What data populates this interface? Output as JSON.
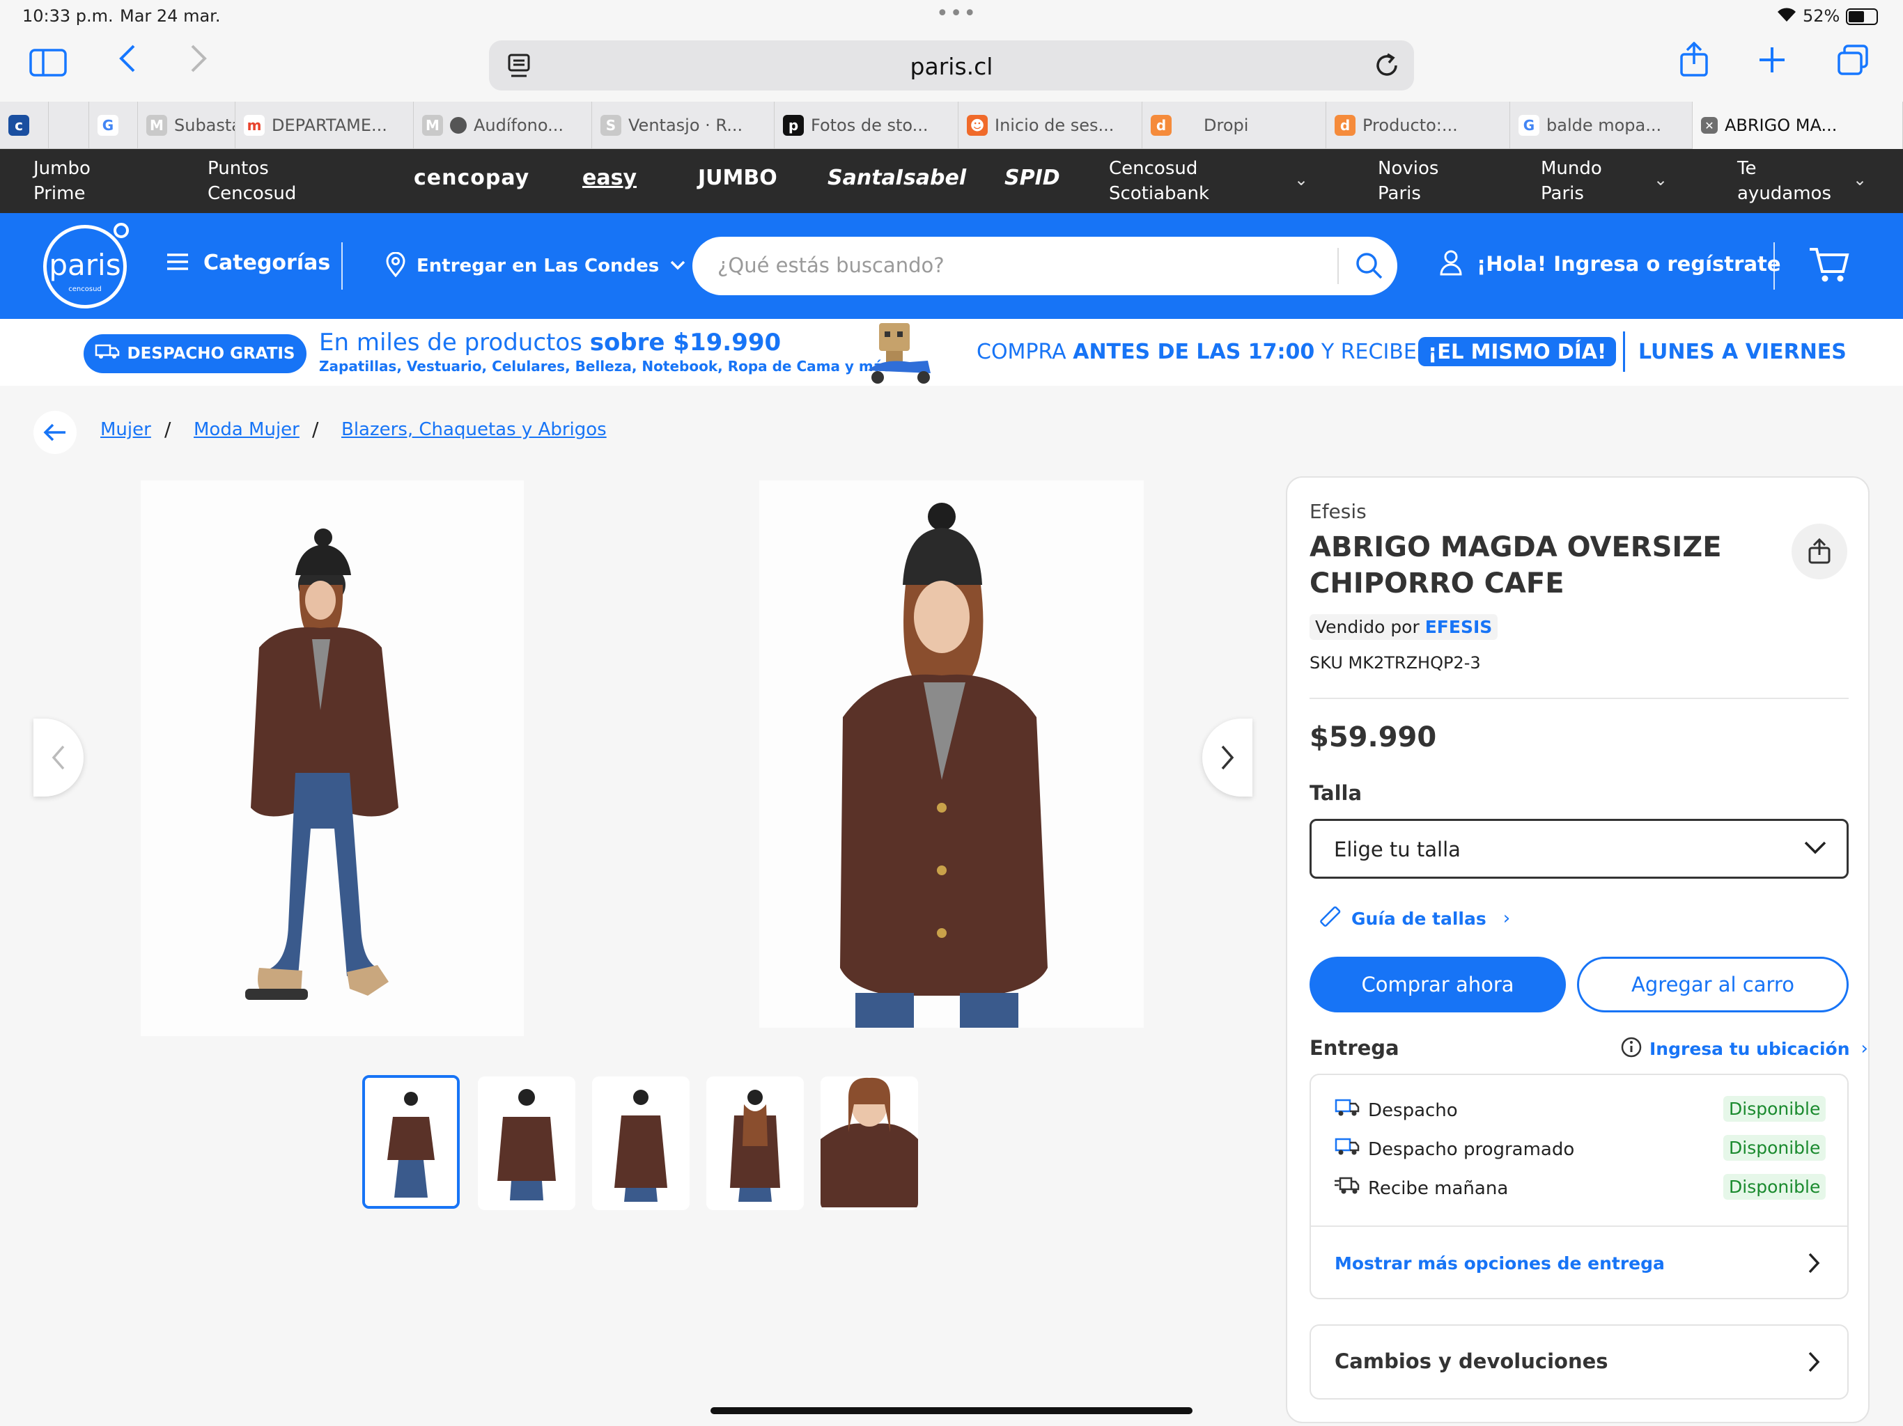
{
  "status": {
    "time": "10:33 p.m.",
    "date": "Mar 24 mar.",
    "battery": "52%"
  },
  "browser": {
    "url": "paris.cl",
    "tabs": [
      {
        "label": "",
        "icon": "cencosud-icon"
      },
      {
        "label": "",
        "icon": "blank"
      },
      {
        "label": "",
        "icon": "google-icon"
      },
      {
        "label": "Subasta",
        "icon": "gmail-icon"
      },
      {
        "label": "DEPARTAME...",
        "icon": "mercadolibre-icon"
      },
      {
        "label": "Audífono...",
        "icon": "gmail-icon"
      },
      {
        "label": "Ventasjo · R...",
        "icon": "s-icon"
      },
      {
        "label": "Fotos de sto...",
        "icon": "photo-icon"
      },
      {
        "label": "Inicio de ses...",
        "icon": "bot-icon"
      },
      {
        "label": "Dropi",
        "icon": "dropi-icon"
      },
      {
        "label": "Producto:...",
        "icon": "dropi-icon"
      },
      {
        "label": "balde mopa...",
        "icon": "google-icon"
      },
      {
        "label": "ABRIGO MA...",
        "icon": "close-icon"
      }
    ]
  },
  "sitesbar": {
    "jumbo_prime": [
      "Jumbo",
      "Prime"
    ],
    "puntos": [
      "Puntos",
      "Cencosud"
    ],
    "brands": [
      "cencopay",
      "easy",
      "JUMBO",
      "SantaIsabel",
      "SPID"
    ],
    "scotiabank": [
      "Cencosud",
      "Scotiabank"
    ],
    "novios": [
      "Novios",
      "Paris"
    ],
    "mundo": [
      "Mundo",
      "Paris"
    ],
    "ayuda": [
      "Te",
      "ayudamos"
    ]
  },
  "header": {
    "logo_text": "paris",
    "logo_sub": "cencosud",
    "categories": "Categorías",
    "delivery": "Entregar en Las Condes",
    "search_placeholder": "¿Qué estás buscando?",
    "login": "¡Hola! Ingresa o regístrate"
  },
  "promo": {
    "pill": "DESPACHO GRATIS",
    "line1_a": "En miles de productos ",
    "line1_b": "sobre $19.990",
    "line2": "Zapatillas, Vestuario, Celulares, Belleza, Notebook, Ropa de Cama y más!",
    "compra_a": "COMPRA ",
    "compra_b": "ANTES DE LAS 17:00",
    "compra_c": " Y RECIBE",
    "mismo_dia": "¡EL MISMO DÍA!",
    "lunes": "LUNES A VIERNES"
  },
  "breadcrumb": [
    "Mujer",
    "Moda Mujer",
    "Blazers, Chaquetas y Abrigos"
  ],
  "product": {
    "brand": "Efesis",
    "title_line1": "ABRIGO MAGDA OVERSIZE",
    "title_line2": "CHIPORRO CAFE",
    "sold_by_label": "Vendido por",
    "seller": "EFESIS",
    "sku": "SKU MK2TRZHQP2-3",
    "price": "$59.990",
    "size_label": "Talla",
    "size_placeholder": "Elige tu talla",
    "size_guide": "Guía de tallas",
    "buy_now": "Comprar ahora",
    "add_to_cart": "Agregar al carro",
    "delivery_label": "Entrega",
    "location_link": "Ingresa tu ubicación",
    "delivery_options": [
      {
        "name": "Despacho",
        "status": "Disponible"
      },
      {
        "name": "Despacho programado",
        "status": "Disponible"
      },
      {
        "name": "Recibe mañana",
        "status": "Disponible"
      }
    ],
    "more_options": "Mostrar más opciones de entrega",
    "returns": "Cambios y devoluciones"
  },
  "colors": {
    "brand_blue": "#1774f6",
    "coat_brown": "#5a3228",
    "jeans": "#3a5a8c"
  }
}
